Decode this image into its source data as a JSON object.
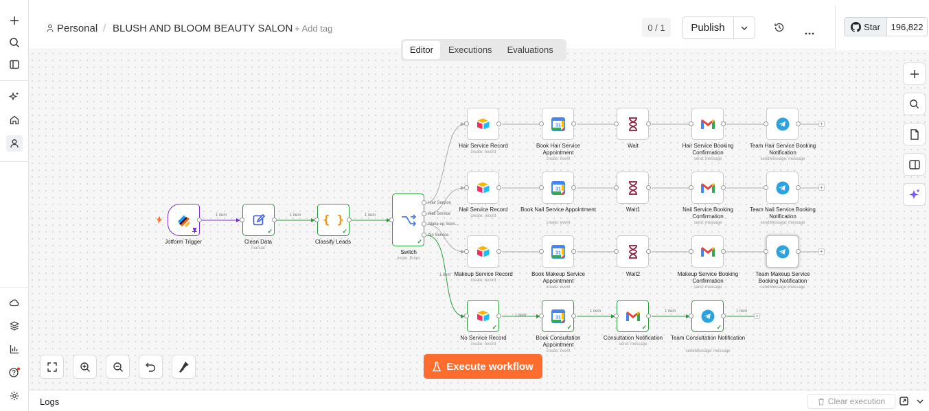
{
  "breadcrumb": {
    "project": "Personal",
    "separator": "/",
    "workflow_name": "BLUSH AND BLOOM BEAUTY SALON",
    "add_tag": "+ Add tag"
  },
  "header": {
    "version_counter": "0 / 1",
    "publish_label": "Publish"
  },
  "github": {
    "star_label": "Star",
    "star_count": "196,822"
  },
  "tabs": [
    {
      "label": "Editor",
      "active": true
    },
    {
      "label": "Executions",
      "active": false
    },
    {
      "label": "Evaluations",
      "active": false
    }
  ],
  "rail_icons": [
    "plus-icon",
    "search-icon",
    "panel-toggle-icon",
    "sparkles-icon",
    "home-icon",
    "user-icon",
    "cloud-icon",
    "templates-icon",
    "insights-icon",
    "help-icon",
    "settings-icon"
  ],
  "canvas_tools": [
    "zoom-to-fit-icon",
    "zoom-in-icon",
    "zoom-out-icon",
    "undo-icon",
    "tidy-up-icon"
  ],
  "right_tools": [
    "add-node-icon",
    "search-nodes-icon",
    "sticky-note-icon",
    "side-panel-icon",
    "ai-assistant-icon"
  ],
  "execute_label": "Execute workflow",
  "logs": {
    "label": "Logs",
    "clear_label": "Clear execution"
  },
  "colors": {
    "accent": "#ff6d2e",
    "success": "#2c9a3e",
    "trigger": "#7b2fd6",
    "airtable": "#18bfff",
    "gcal": "#4285f4",
    "gmail": "#ea4335",
    "telegram": "#2aa3e0",
    "wait": "#8b1d3c"
  },
  "nodes": {
    "jotform": {
      "label": "Jotform Trigger"
    },
    "clean": {
      "label": "Clean Data",
      "sub": "manual"
    },
    "classify": {
      "label": "Classify Leads"
    },
    "switch": {
      "label": "Switch",
      "sub": "mode: Rules",
      "outputs": [
        "Hair Service",
        "Nail Service",
        "Make-up Servi...",
        "No Service"
      ]
    },
    "hair_record": {
      "label": "Hair Service Record",
      "sub": "create: record"
    },
    "hair_book": {
      "label": "Book Hair Service Appointment",
      "sub": "create: event"
    },
    "hair_wait": {
      "label": "Wait"
    },
    "hair_mail": {
      "label": "Hair Service Booking Confirmation",
      "sub": "send: message"
    },
    "hair_tg": {
      "label": "Team Hair Service Booking Notification",
      "sub": "sendMessage: message"
    },
    "nail_record": {
      "label": "Nail Service Record",
      "sub": "create: record"
    },
    "nail_book": {
      "label": "Book Nail Service Appointment",
      "sub": "create: event"
    },
    "nail_wait": {
      "label": "Wait1"
    },
    "nail_mail": {
      "label": "Nail Service Booking Confirmation",
      "sub": "send: message"
    },
    "nail_tg": {
      "label": "Team Nail Service Booking Notification",
      "sub": "sendMessage: message"
    },
    "mk_record": {
      "label": "Makeup Service Record",
      "sub": "create: record"
    },
    "mk_book": {
      "label": "Book Makeup Service Appointment",
      "sub": "create: event"
    },
    "mk_wait": {
      "label": "Wait2"
    },
    "mk_mail": {
      "label": "Makeup Service Booking Confirmation",
      "sub": "send: message"
    },
    "mk_tg": {
      "label": "Team Makeup Service Booking Notification",
      "sub": "sendMessage: message"
    },
    "no_record": {
      "label": "No Service Record",
      "sub": "create: record"
    },
    "no_book": {
      "label": "Book Consultation Appointment",
      "sub": "create: event"
    },
    "no_mail": {
      "label": "Consultation Notification",
      "sub": "send: message"
    },
    "no_tg": {
      "label": "Team Consultation Notification",
      "sub": "sendMessage: message"
    }
  },
  "edge_label": "1 item"
}
